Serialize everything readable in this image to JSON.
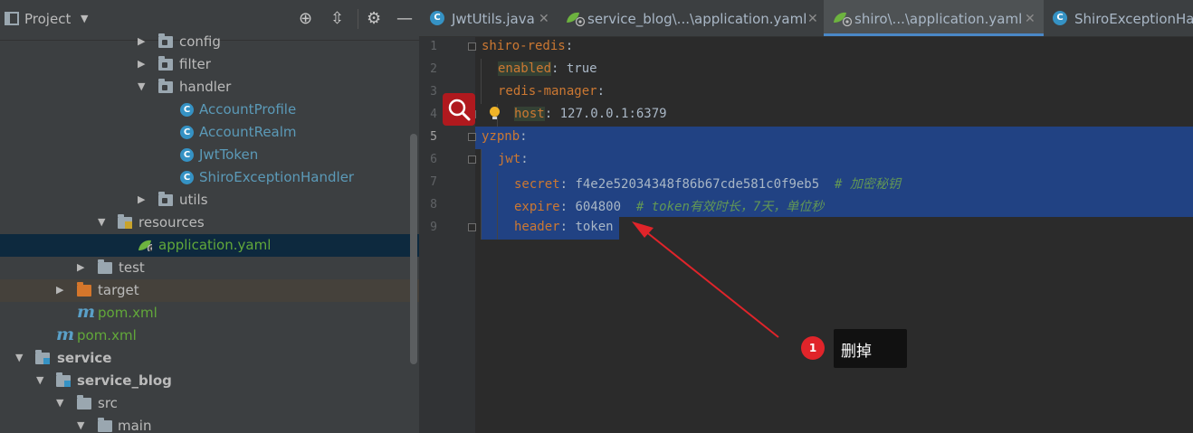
{
  "project_panel": {
    "title": "Project",
    "tree": [
      {
        "label": "config",
        "type": "folder",
        "expanded": false
      },
      {
        "label": "filter",
        "type": "folder",
        "expanded": false
      },
      {
        "label": "handler",
        "type": "folder",
        "expanded": true
      },
      {
        "label": "AccountProfile",
        "type": "class"
      },
      {
        "label": "AccountRealm",
        "type": "class"
      },
      {
        "label": "JwtToken",
        "type": "class"
      },
      {
        "label": "ShiroExceptionHandler",
        "type": "class"
      },
      {
        "label": "utils",
        "type": "folder",
        "expanded": false
      },
      {
        "label": "resources",
        "type": "resources-folder",
        "expanded": true
      },
      {
        "label": "application.yaml",
        "type": "yaml",
        "selected": true
      },
      {
        "label": "test",
        "type": "folder",
        "expanded": false
      },
      {
        "label": "target",
        "type": "excluded-folder",
        "expanded": false
      },
      {
        "label": "pom.xml",
        "type": "maven"
      },
      {
        "label": "pom.xml",
        "type": "maven"
      },
      {
        "label": "service",
        "type": "module",
        "expanded": true
      },
      {
        "label": "service_blog",
        "type": "module",
        "expanded": true
      },
      {
        "label": "src",
        "type": "folder",
        "expanded": true
      },
      {
        "label": "main",
        "type": "folder",
        "expanded": true
      }
    ]
  },
  "tabs": [
    {
      "label": "JwtUtils.java",
      "icon": "java-class-icon",
      "active": false
    },
    {
      "label": "service_blog\\...\\application.yaml",
      "icon": "spring-yaml-icon",
      "active": false
    },
    {
      "label": "shiro\\...\\application.yaml",
      "icon": "spring-yaml-icon",
      "active": true
    },
    {
      "label": "ShiroExceptionHa",
      "icon": "java-class-icon",
      "active": false
    }
  ],
  "editor": {
    "line_numbers": [
      "1",
      "2",
      "3",
      "4",
      "5",
      "6",
      "7",
      "8",
      "9"
    ],
    "lines": [
      {
        "key": "shiro-redis",
        "value": ""
      },
      {
        "key": "enabled",
        "value": " true"
      },
      {
        "key": "redis-manager",
        "value": ""
      },
      {
        "key": "host",
        "value": " 127.0.0.1:6379"
      },
      {
        "key": "yzpnb",
        "value": ""
      },
      {
        "key": "jwt",
        "value": ""
      },
      {
        "key": "secret",
        "value": " f4e2e52034348f86b67cde581c0f9eb5  ",
        "comment": "# 加密秘钥"
      },
      {
        "key": "expire",
        "value": " 604800  ",
        "comment": "# token有效时长，7天，单位秒"
      },
      {
        "key": "header",
        "value": " token"
      }
    ]
  },
  "annotation": {
    "step": "1",
    "text": "删掉"
  },
  "colors": {
    "selection": "#214283",
    "key": "#cc7832",
    "comment": "#629755",
    "accent_red": "#e0242a"
  }
}
